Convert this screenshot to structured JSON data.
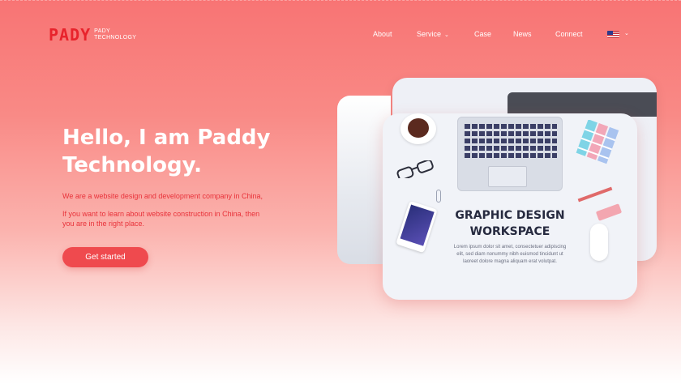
{
  "logo": {
    "mark": "PADY",
    "line1": "PADY",
    "line2": "TECHNOLOGY"
  },
  "nav": {
    "items": [
      {
        "label": "About"
      },
      {
        "label": "Service",
        "has_dropdown": true
      },
      {
        "label": "Case"
      },
      {
        "label": "News"
      },
      {
        "label": "Connect"
      }
    ],
    "language_flag": "us-flag-icon"
  },
  "hero": {
    "title": "Hello, I am Paddy Technology.",
    "paragraph1": "We are a website design and development company in China,",
    "paragraph2": "If you want to learn about website construction in China, then you are in the right place.",
    "cta_label": "Get started"
  },
  "illustration": {
    "title": "GRAPHIC DESIGN WORKSPACE",
    "body": "Lorem ipsum dolor sit amet, consectetuer adipiscing elit, sed diam nonummy nibh euismod tincidunt ut laoreet dolore magna aliquam erat volutpat."
  },
  "colors": {
    "accent": "#ef4a4e",
    "brand_red": "#e8232c",
    "text_red": "#e8323a"
  }
}
